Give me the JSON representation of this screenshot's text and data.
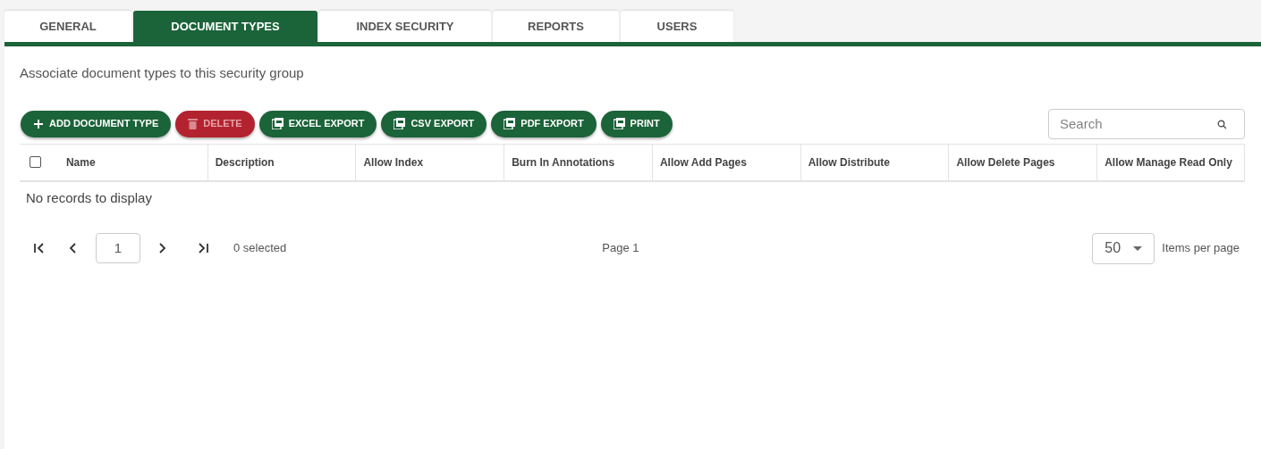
{
  "tabs": [
    {
      "label": "GENERAL",
      "selected": false
    },
    {
      "label": "DOCUMENT TYPES",
      "selected": true
    },
    {
      "label": "INDEX SECURITY",
      "selected": false
    },
    {
      "label": "REPORTS",
      "selected": false
    },
    {
      "label": "USERS",
      "selected": false
    }
  ],
  "description": "Associate document types to this security group",
  "toolbar": [
    {
      "label": "ADD DOCUMENT TYPE",
      "kind": "add",
      "disabled": false
    },
    {
      "label": "DELETE",
      "kind": "delete",
      "disabled": true
    },
    {
      "label": "EXCEL EXPORT",
      "kind": "export",
      "disabled": false
    },
    {
      "label": "CSV EXPORT",
      "kind": "export",
      "disabled": false
    },
    {
      "label": "PDF EXPORT",
      "kind": "export",
      "disabled": false
    },
    {
      "label": "PRINT",
      "kind": "export",
      "disabled": false
    }
  ],
  "search": {
    "placeholder": "Search"
  },
  "table": {
    "select_all": {
      "checked": false
    },
    "columns": [
      "Name",
      "Description",
      "Allow Index",
      "Burn In Annotations",
      "Allow Add Pages",
      "Allow Distribute",
      "Allow Delete Pages",
      "Allow Manage Read Only"
    ],
    "empty_message": "No records to display"
  },
  "pager": {
    "page_input": "1",
    "selected_count": "0 selected",
    "page_label": "Page 1",
    "page_size": "50",
    "page_size_label": "Items per page"
  }
}
